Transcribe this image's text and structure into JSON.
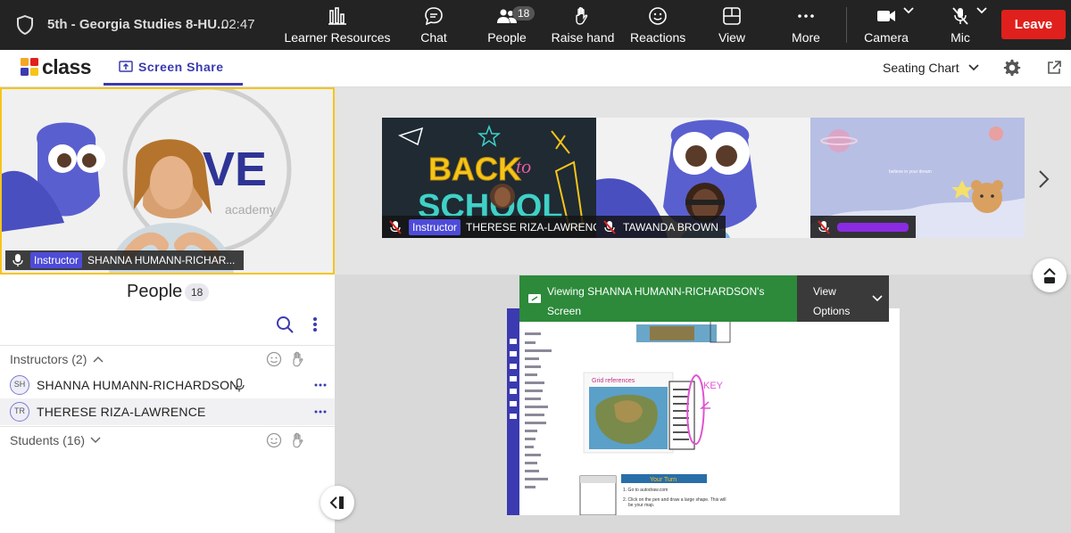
{
  "topbar": {
    "meeting_title": "5th - Georgia Studies 8-HU...",
    "timer": "02:47",
    "buttons": {
      "learner_resources": "Learner Resources",
      "chat": "Chat",
      "people": "People",
      "people_count": "18",
      "raise_hand": "Raise hand",
      "reactions": "Reactions",
      "view": "View",
      "more": "More",
      "camera": "Camera",
      "mic": "Mic",
      "leave": "Leave"
    }
  },
  "subbar": {
    "logo_text": "class",
    "tab_label": "Screen Share",
    "seating_chart": "Seating Chart"
  },
  "main_video": {
    "role": "Instructor",
    "name": "SHANNA HUMANN-RICHAR..."
  },
  "gallery": {
    "tiles": [
      {
        "role": "Instructor",
        "name": "THERESE RIZA-LAWRENCE"
      },
      {
        "name": "TAWANDA BROWN"
      },
      {
        "name": ""
      }
    ]
  },
  "people_panel": {
    "title": "People",
    "count": "18",
    "instructors_header": "Instructors (2)",
    "instructors": [
      {
        "initials": "SH",
        "name": "SHANNA HUMANN-RICHARDSON"
      },
      {
        "initials": "TR",
        "name": "THERESE RIZA-LAWRENCE"
      }
    ],
    "students_header": "Students (16)"
  },
  "share": {
    "banner_text": "Viewing SHANNA HUMANN-RICHARDSON's Screen",
    "view_options": "View Options"
  },
  "colors": {
    "accent": "#3b3ab0",
    "leave": "#e0201c",
    "banner": "#2c8a3a",
    "highlight_border": "#f5c518"
  }
}
